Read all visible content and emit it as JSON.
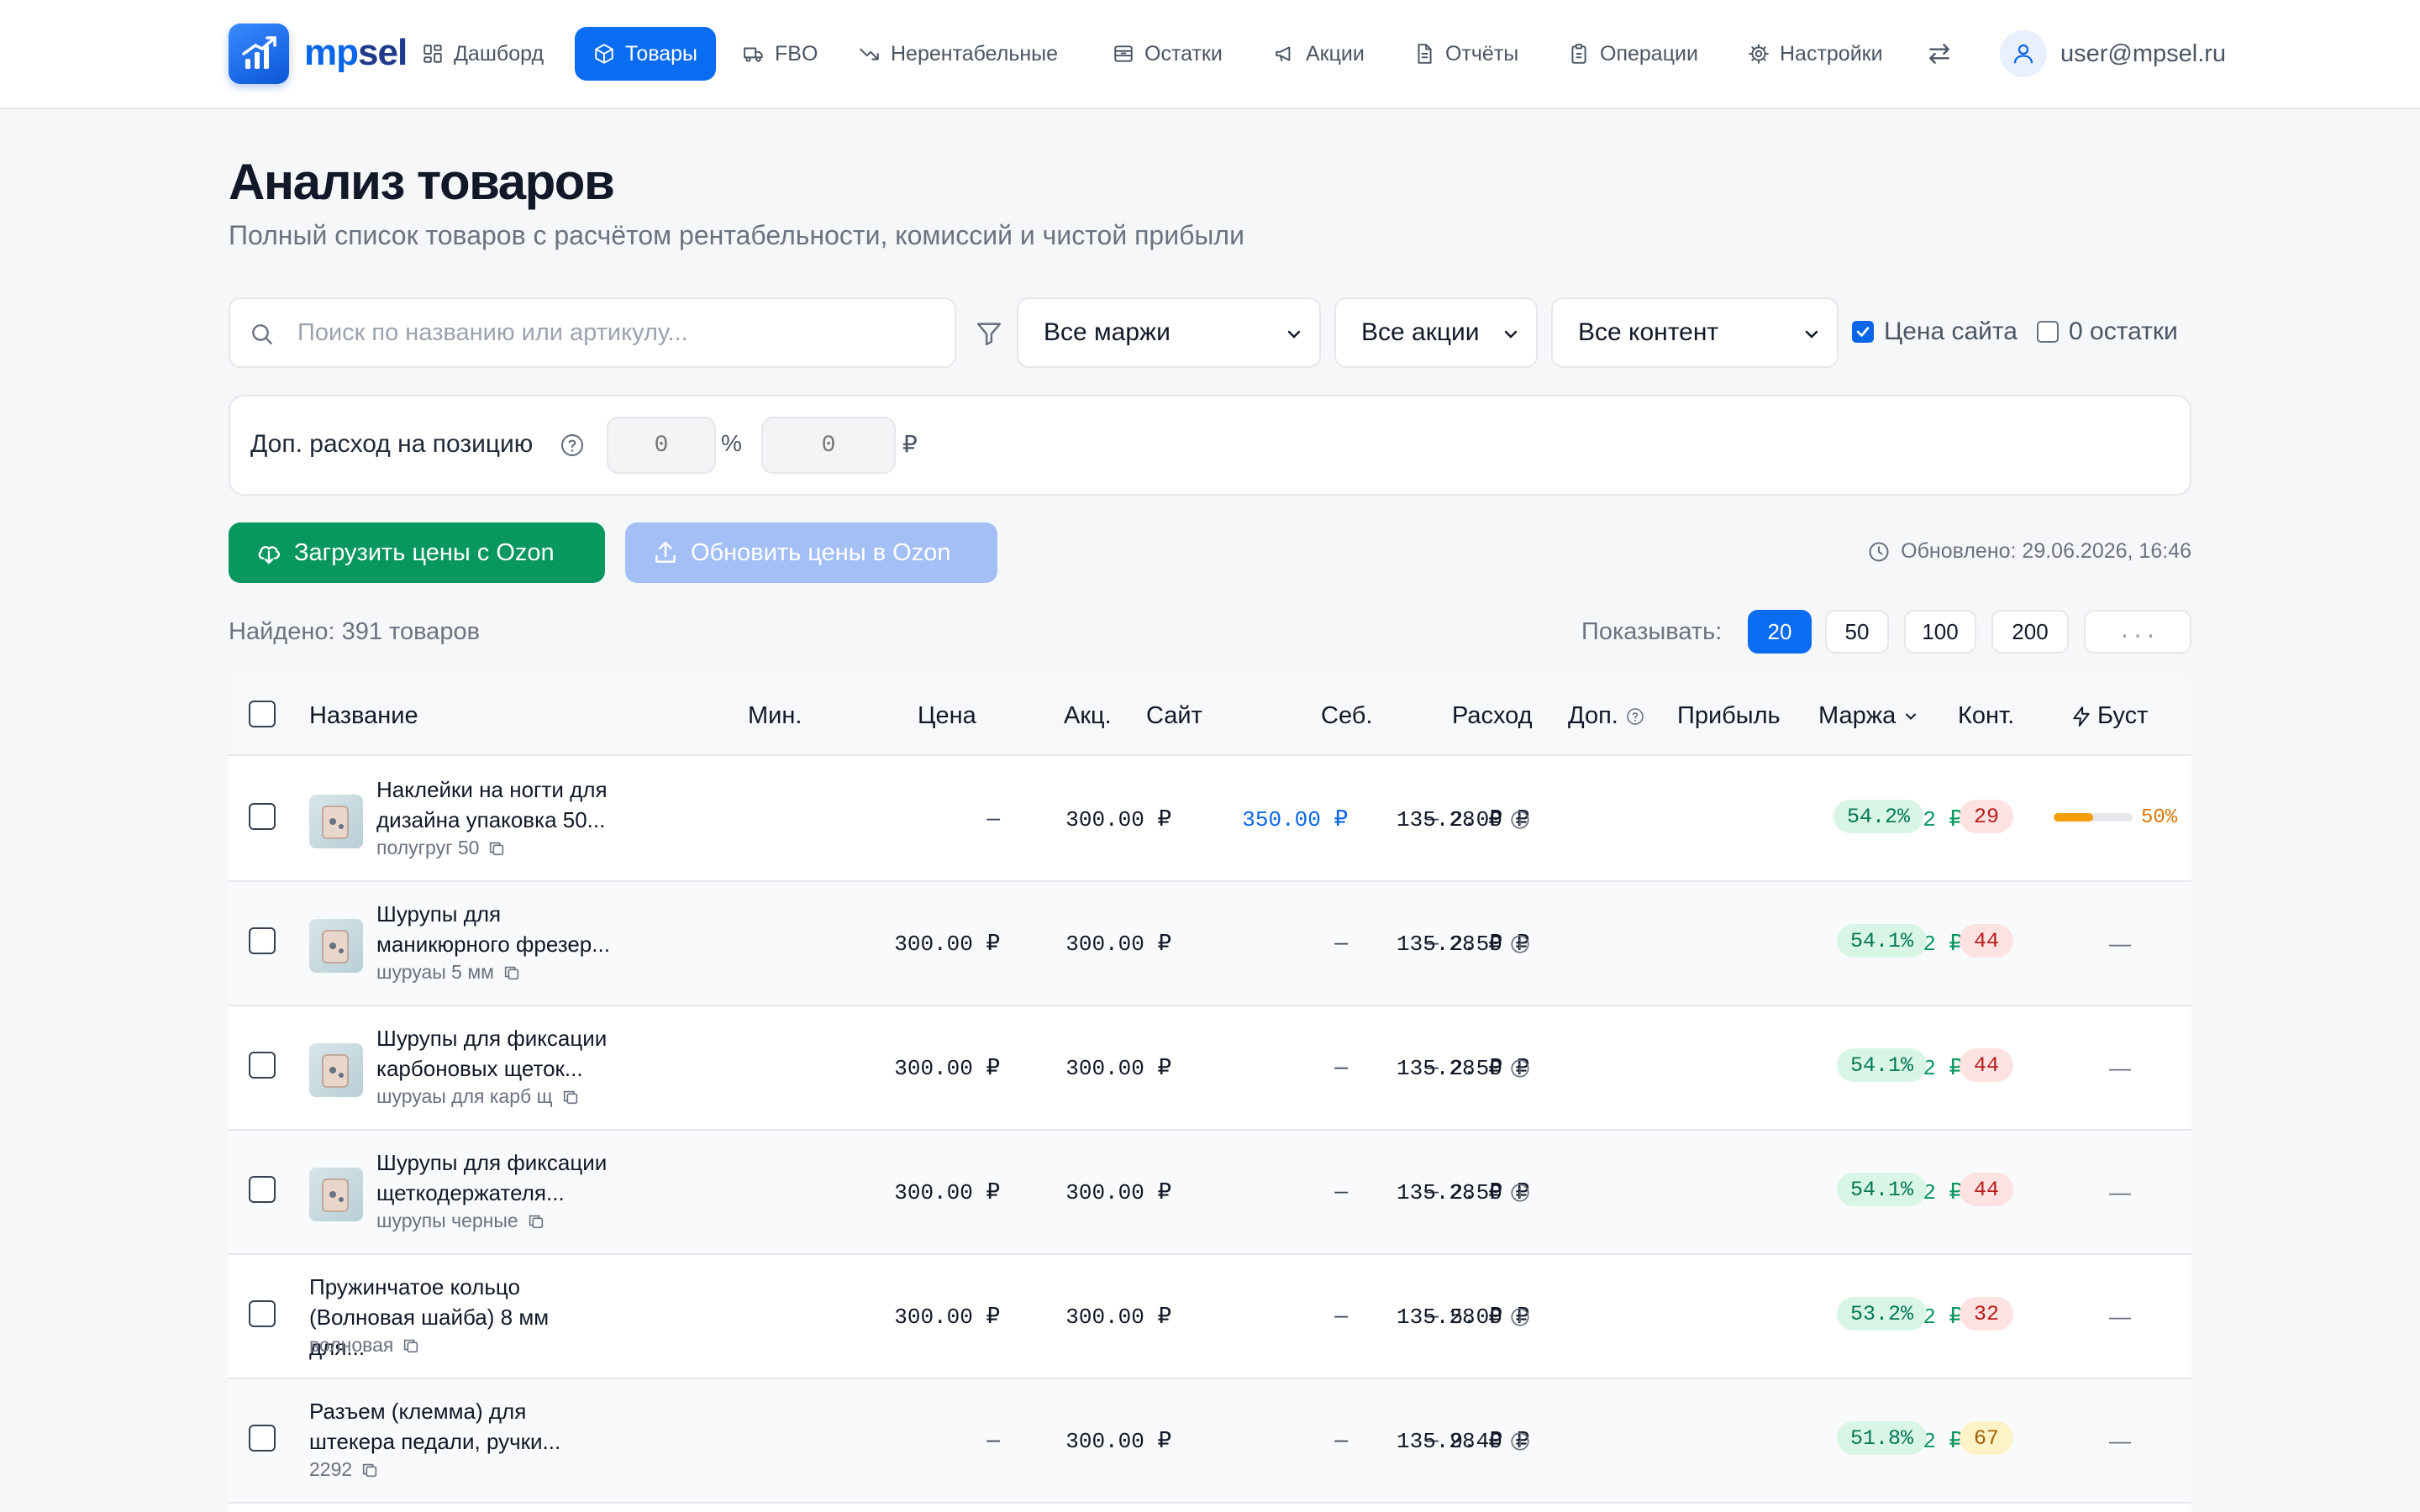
{
  "nav": {
    "logo_mp": "mp",
    "logo_sel": "sel",
    "items": [
      {
        "label": "Дашборд",
        "icon": "dashboard-icon"
      },
      {
        "label": "Товары",
        "icon": "box-icon",
        "active": true
      },
      {
        "label": "FBO",
        "icon": "truck-icon"
      },
      {
        "label": "Нерентабельные",
        "icon": "trend-down-icon"
      },
      {
        "label": "Остатки",
        "icon": "archive-icon"
      },
      {
        "label": "Акции",
        "icon": "megaphone-icon"
      },
      {
        "label": "Отчёты",
        "icon": "document-icon"
      },
      {
        "label": "Операции",
        "icon": "clipboard-icon"
      },
      {
        "label": "Настройки",
        "icon": "gear-icon"
      }
    ],
    "user_email": "user@mpsel.ru"
  },
  "header": {
    "title": "Анализ товаров",
    "subtitle": "Полный список товаров с расчётом рентабельности, комиссий и чистой прибыли"
  },
  "filters": {
    "search_placeholder": "Поиск по названию или артикулу...",
    "margin_select": "Все маржи",
    "promo_select": "Все акции",
    "content_select": "Все контент",
    "site_price_label": "Цена сайта",
    "site_price_checked": true,
    "zero_stock_label": "0 остатки",
    "zero_stock_checked": false
  },
  "extra": {
    "label": "Доп. расход на позицию",
    "percent_value": "0",
    "percent_unit": "%",
    "rub_value": "0",
    "rub_unit": "₽"
  },
  "actions": {
    "load_prices": "Загрузить цены с Ozon",
    "update_prices": "Обновить цены в Ozon",
    "updated": "Обновлено: 29.06.2026, 16:46"
  },
  "listing": {
    "found": "Найдено: 391 товаров",
    "show_label": "Показывать:",
    "page_sizes": [
      "20",
      "50",
      "100",
      "200"
    ],
    "page_size_active": "20",
    "custom_placeholder": "..."
  },
  "table": {
    "headers": {
      "name": "Название",
      "min": "Мин.",
      "price": "Цена",
      "promo": "Акц.",
      "site": "Сайт",
      "cost": "Себ.",
      "expense": "Расход",
      "extra": "Доп.",
      "profit": "Прибыль",
      "margin": "Маржа",
      "content": "Конт.",
      "boost": "Буст"
    },
    "rows": [
      {
        "name_l1": "Наклейки на ногти для",
        "name_l2": "дизайна упаковка 50...",
        "sku": "полугруг 50",
        "has_thumb": true,
        "min": "—",
        "price": "300.00 ₽",
        "promo": "350.00 ₽",
        "site": "—",
        "cost": "2.00 ₽",
        "expense": "135.28 ₽",
        "extra": "—",
        "profit": "162.72 ₽",
        "margin": "54.2%",
        "content": "29",
        "content_color": "red",
        "boost": "50%",
        "boost_level": 0.5
      },
      {
        "name_l1": "Шурупы для",
        "name_l2": "маникюрного фрезер...",
        "sku": "шуруаы 5 мм",
        "has_thumb": true,
        "min": "300.00 ₽",
        "price": "300.00 ₽",
        "promo": "—",
        "site": "—",
        "cost": "2.50 ₽",
        "expense": "135.28 ₽",
        "extra": "—",
        "profit": "162.22 ₽",
        "margin": "54.1%",
        "content": "44",
        "content_color": "red",
        "boost": "—"
      },
      {
        "name_l1": "Шурупы для фиксации",
        "name_l2": "карбоновых щеток...",
        "sku": "шуруаы для карб щ",
        "has_thumb": true,
        "min": "300.00 ₽",
        "price": "300.00 ₽",
        "promo": "—",
        "site": "—",
        "cost": "2.50 ₽",
        "expense": "135.28 ₽",
        "extra": "—",
        "profit": "162.22 ₽",
        "margin": "54.1%",
        "content": "44",
        "content_color": "red",
        "boost": "—"
      },
      {
        "name_l1": "Шурупы для фиксации",
        "name_l2": "щеткодержателя...",
        "sku": "шурупы черные",
        "has_thumb": true,
        "min": "300.00 ₽",
        "price": "300.00 ₽",
        "promo": "—",
        "site": "—",
        "cost": "2.50 ₽",
        "expense": "135.28 ₽",
        "extra": "—",
        "profit": "162.22 ₽",
        "margin": "54.1%",
        "content": "44",
        "content_color": "red",
        "boost": "—"
      },
      {
        "name_l1": "Пружинчатое кольцо",
        "name_l2": "(Волновая шайба) 8 мм для...",
        "sku": "волновая",
        "has_thumb": false,
        "min": "300.00 ₽",
        "price": "300.00 ₽",
        "promo": "—",
        "site": "—",
        "cost": "5.00 ₽",
        "expense": "135.28 ₽",
        "extra": "—",
        "profit": "159.72 ₽",
        "margin": "53.2%",
        "content": "32",
        "content_color": "red",
        "boost": "—"
      },
      {
        "name_l1": "Разъем (клемма) для",
        "name_l2": "штекера педали, ручки...",
        "sku": "2292",
        "has_thumb": false,
        "min": "—",
        "price": "300.00 ₽",
        "promo": "—",
        "site": "—",
        "cost": "9.40 ₽",
        "expense": "135.28 ₽",
        "extra": "—",
        "profit": "155.32 ₽",
        "margin": "51.8%",
        "content": "67",
        "content_color": "yellow",
        "boost": "—"
      }
    ]
  },
  "colors": {
    "accent": "#0a6cf0",
    "green": "#07975f",
    "profit": "#07975f",
    "boost": "#f59e0b"
  }
}
